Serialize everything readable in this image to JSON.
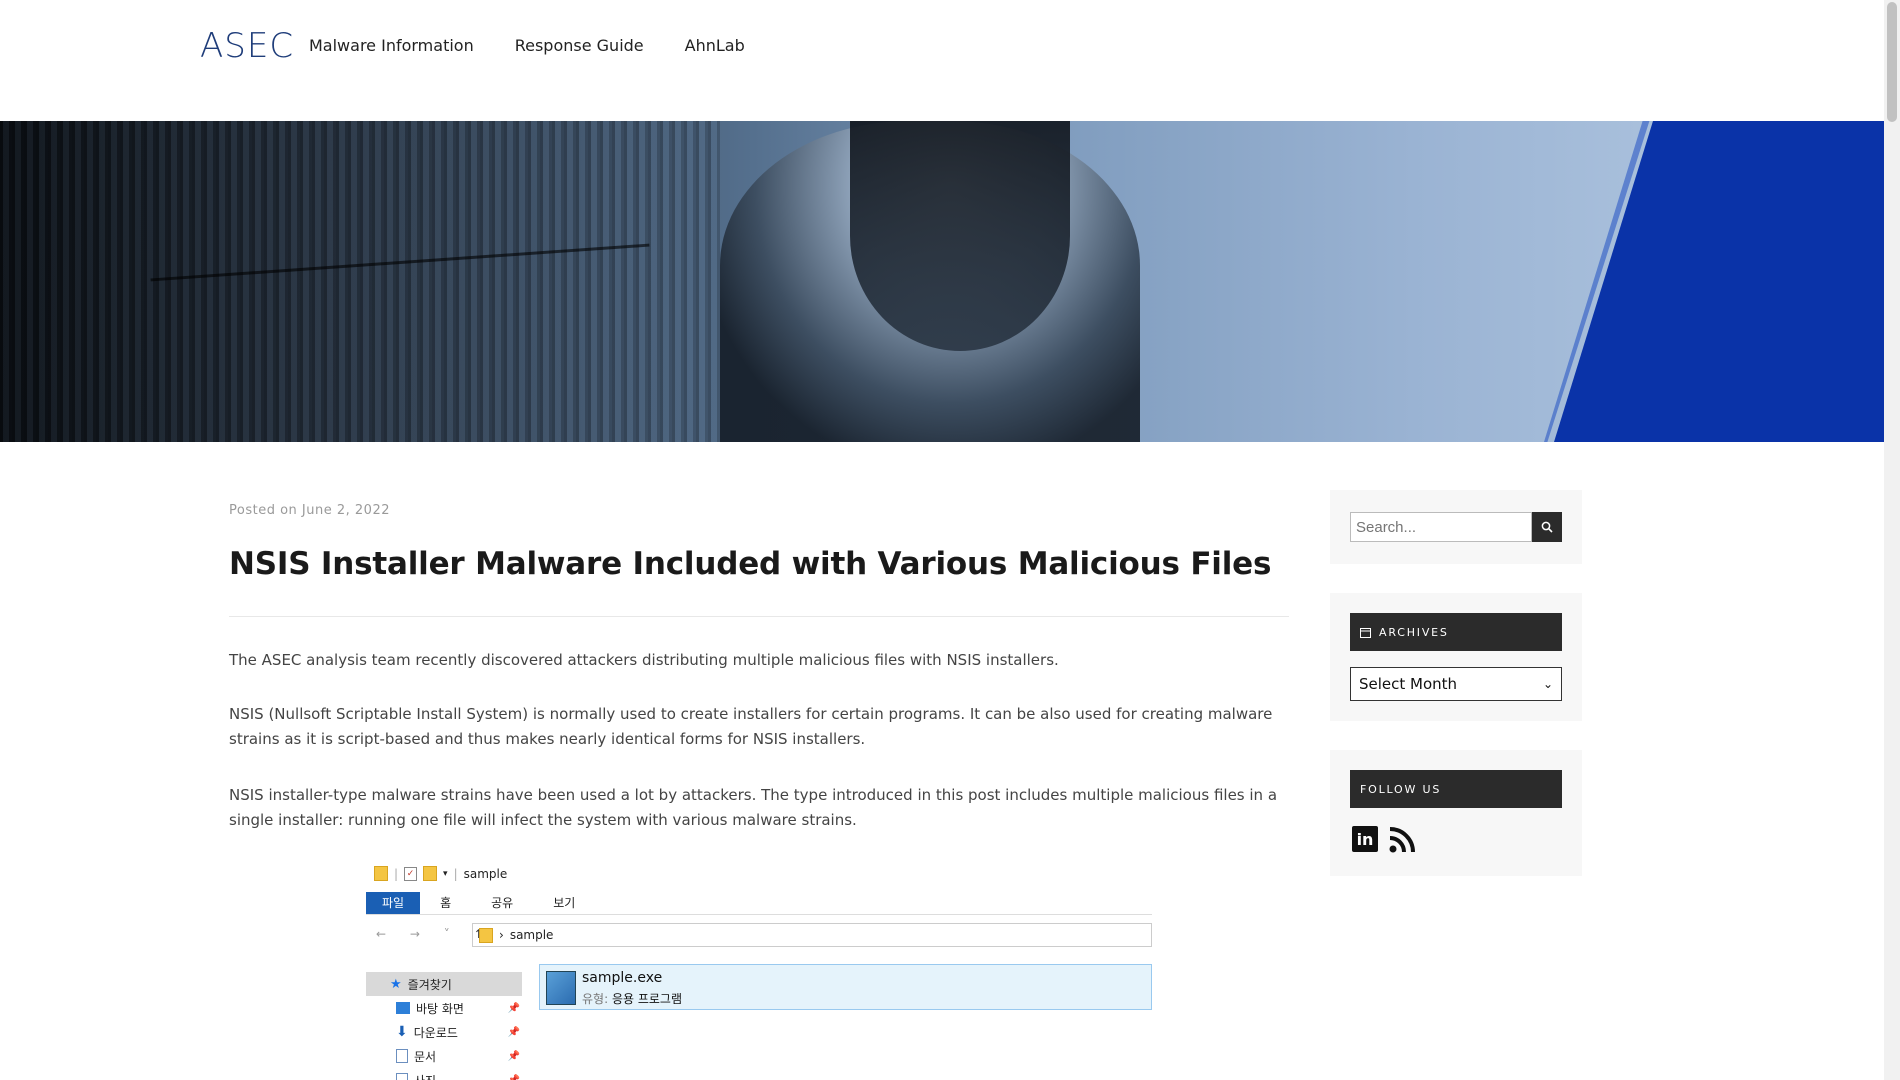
{
  "header": {
    "logo": "ASEC",
    "nav": [
      "Malware Information",
      "Response Guide",
      "AhnLab"
    ]
  },
  "post": {
    "posted_prefix": "Posted on",
    "date": "June 2, 2022",
    "title": "NSIS Installer Malware Included with Various Malicious Files",
    "paragraphs": [
      "The ASEC analysis team recently discovered attackers distributing multiple malicious files with NSIS installers.",
      "NSIS (Nullsoft Scriptable Install System) is normally used to create installers for certain programs. It can be also used for creating malware strains as it is script-based and thus makes nearly identical forms for NSIS installers.",
      "NSIS installer-type malware strains have been used a lot by attackers. The type introduced in this post includes multiple malicious files in a single installer: running one file will infect the system with various malware strains."
    ]
  },
  "explorer": {
    "window_title": "sample",
    "ribbon": [
      "파일",
      "홈",
      "공유",
      "보기"
    ],
    "address": "sample",
    "nav_items": [
      "즐겨찾기",
      "바탕 화면",
      "다운로드",
      "문서",
      "사진"
    ],
    "file": {
      "name": "sample.exe",
      "type_label": "유형:",
      "type_value": "응용 프로그램"
    }
  },
  "sidebar": {
    "search_placeholder": "Search...",
    "archives_title": "ARCHIVES",
    "archives_select": "Select Month",
    "follow_title": "FOLLOW US",
    "social": [
      "linkedin-icon",
      "rss-icon"
    ]
  },
  "colors": {
    "brand": "#1f3d7a",
    "widget_header": "#2b2b2b",
    "banner_blue": "#0a33a8"
  }
}
